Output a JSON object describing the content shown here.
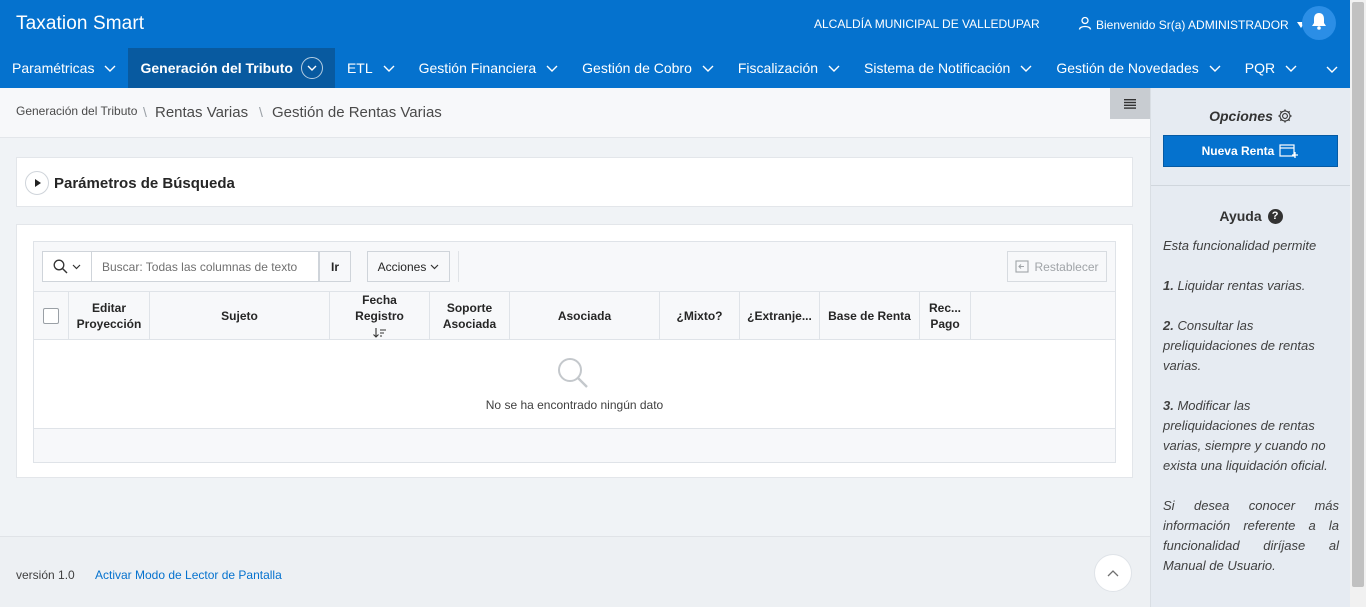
{
  "header": {
    "app_title": "Taxation Smart",
    "municipality": "ALCALDÍA MUNICIPAL DE VALLEDUPAR",
    "welcome": "Bienvenido Sr(a) ADMINISTRADOR"
  },
  "nav": {
    "items": [
      {
        "label": "Paramétricas"
      },
      {
        "label": "Generación del Tributo",
        "active": true
      },
      {
        "label": "ETL"
      },
      {
        "label": "Gestión Financiera"
      },
      {
        "label": "Gestión de Cobro"
      },
      {
        "label": "Fiscalización"
      },
      {
        "label": "Sistema de Notificación"
      },
      {
        "label": "Gestión de Novedades"
      },
      {
        "label": "PQR"
      }
    ]
  },
  "breadcrumb": {
    "items": [
      "Generación del Tributo",
      "Rentas Varias",
      "Gestión de Rentas Varias"
    ]
  },
  "search_region": {
    "title": "Parámetros de Búsqueda"
  },
  "report": {
    "search_placeholder": "Buscar: Todas las columnas de texto",
    "go_label": "Ir",
    "actions_label": "Acciones",
    "reset_label": "Restablecer",
    "columns": [
      {
        "label": "Editar Proyección"
      },
      {
        "label": "Sujeto"
      },
      {
        "label": "Fecha Registro"
      },
      {
        "label": "Soporte Asociada"
      },
      {
        "label": "Asociada"
      },
      {
        "label": "¿Mixto?"
      },
      {
        "label": "¿Extranje..."
      },
      {
        "label": "Base de Renta"
      },
      {
        "label": "Rec... Pago"
      }
    ],
    "no_data": "No se ha encontrado ningún dato"
  },
  "sidebar": {
    "options_title": "Opciones",
    "new_button": "Nueva Renta",
    "help_title": "Ayuda",
    "help_intro": "Esta funcionalidad permite",
    "help_items": [
      {
        "num": "1.",
        "text": "Liquidar rentas varias."
      },
      {
        "num": "2.",
        "text": "Consultar las preliquidaciones de rentas varias."
      },
      {
        "num": "3.",
        "text": "Modificar las preliquidaciones de rentas varias, siempre y cuando no exista una liquidación oficial."
      }
    ],
    "help_footer": "Si desea conocer más información referente a la funcionalidad diríjase al Manual de Usuario."
  },
  "footer": {
    "version": "versión 1.0",
    "reader_link": "Activar Modo de Lector de Pantalla"
  },
  "colors": {
    "brand": "#0572ce",
    "nav_active": "#085aa0",
    "sidebar_bg": "#e6ebf2"
  }
}
